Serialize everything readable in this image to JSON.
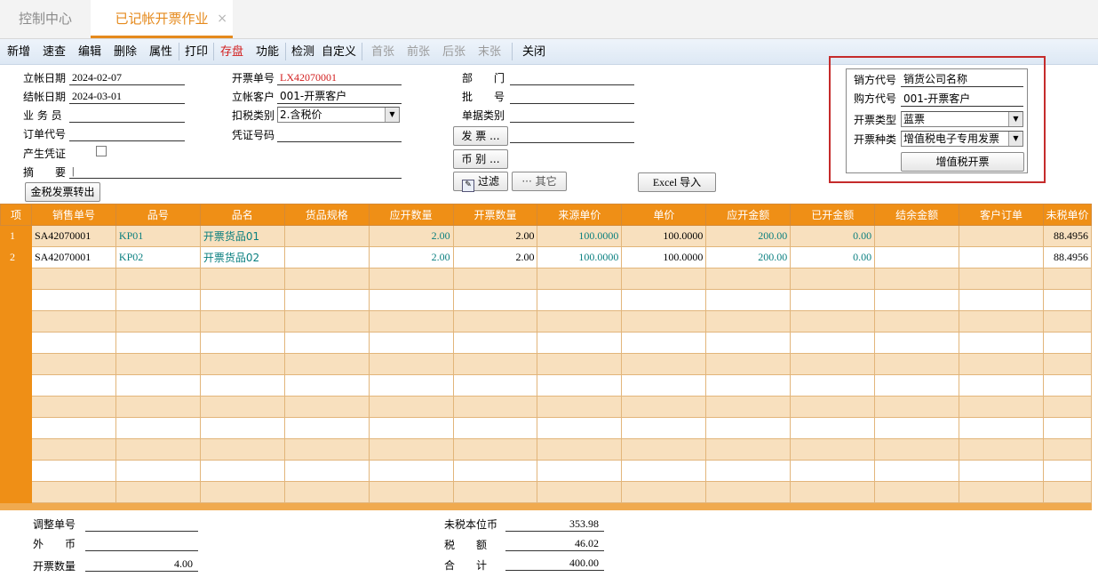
{
  "tabs": {
    "home": "控制中心",
    "active": "已记帐开票作业",
    "close": "×"
  },
  "toolbar": {
    "items": [
      "新增",
      "速查",
      "编辑",
      "删除",
      "属性",
      "打印",
      "存盘",
      "功能",
      "检测",
      "自定义",
      "首张",
      "前张",
      "后张",
      "末张",
      "关闭"
    ]
  },
  "form": {
    "left": {
      "post_date_label": "立帐日期",
      "post_date": "2024-02-07",
      "settle_date_label": "结帐日期",
      "settle_date": "2024-03-01",
      "salesman_label": "业 务 员",
      "salesman": "",
      "order_code_label": "订单代号",
      "order_code": "",
      "voucher_label": "产生凭证",
      "summary_label": "摘　　要",
      "summary": "|",
      "gold_tax_button": "金税发票转出"
    },
    "middle": {
      "invoice_no_label": "开票单号",
      "invoice_no": "LX42070001",
      "customer_label": "立帐客户",
      "customer": "001-开票客户",
      "tax_type_label": "扣税类别",
      "tax_type": "2.含税价",
      "voucher_no_label": "凭证号码",
      "voucher_no": ""
    },
    "right": {
      "dept_label": "部　　门",
      "dept": "",
      "batch_label": "批　　号",
      "batch": "",
      "doc_type_label": "单据类别",
      "doc_type": "",
      "invoice_button": "发 票 ...",
      "invoice": "",
      "currency_button": "币 别 ...",
      "filter_button": "过滤",
      "other_button": "其它",
      "excel_button": "Excel 导入"
    },
    "panel": {
      "seller_label": "销方代号",
      "seller": "销货公司名称",
      "buyer_label": "购方代号",
      "buyer": "001-开票客户",
      "inv_type_label": "开票类型",
      "inv_type": "蓝票",
      "inv_kind_label": "开票种类",
      "inv_kind": "增值税电子专用发票",
      "vat_button": "增值税开票"
    }
  },
  "grid": {
    "headers": [
      "项",
      "销售单号",
      "品号",
      "品名",
      "货品规格",
      "应开数量",
      "开票数量",
      "来源单价",
      "单价",
      "应开金额",
      "已开金额",
      "结余金额",
      "客户订单",
      "未税单价"
    ],
    "rows": [
      {
        "idx": "1",
        "so": "SA42070001",
        "code": "KP01",
        "name": "开票货品01",
        "spec": "",
        "due_qty": "2.00",
        "qty": "2.00",
        "src_price": "100.0000",
        "price": "100.0000",
        "due_amt": "200.00",
        "done_amt": "0.00",
        "bal": "",
        "cust_order": "",
        "notax_price": "88.4956"
      },
      {
        "idx": "2",
        "so": "SA42070001",
        "code": "KP02",
        "name": "开票货品02",
        "spec": "",
        "due_qty": "2.00",
        "qty": "2.00",
        "src_price": "100.0000",
        "price": "100.0000",
        "due_amt": "200.00",
        "done_amt": "0.00",
        "bal": "",
        "cust_order": "",
        "notax_price": "88.4956"
      }
    ]
  },
  "footer": {
    "adjust_no_label": "调整单号",
    "adjust_no": "",
    "foreign_label": "外　　币",
    "foreign": "",
    "qty_label": "开票数量",
    "qty": "4.00",
    "notax_label": "未税本位币",
    "notax": "353.98",
    "tax_label": "税　　额",
    "tax": "46.02",
    "total_label": "合　　计",
    "total": "400.00"
  }
}
